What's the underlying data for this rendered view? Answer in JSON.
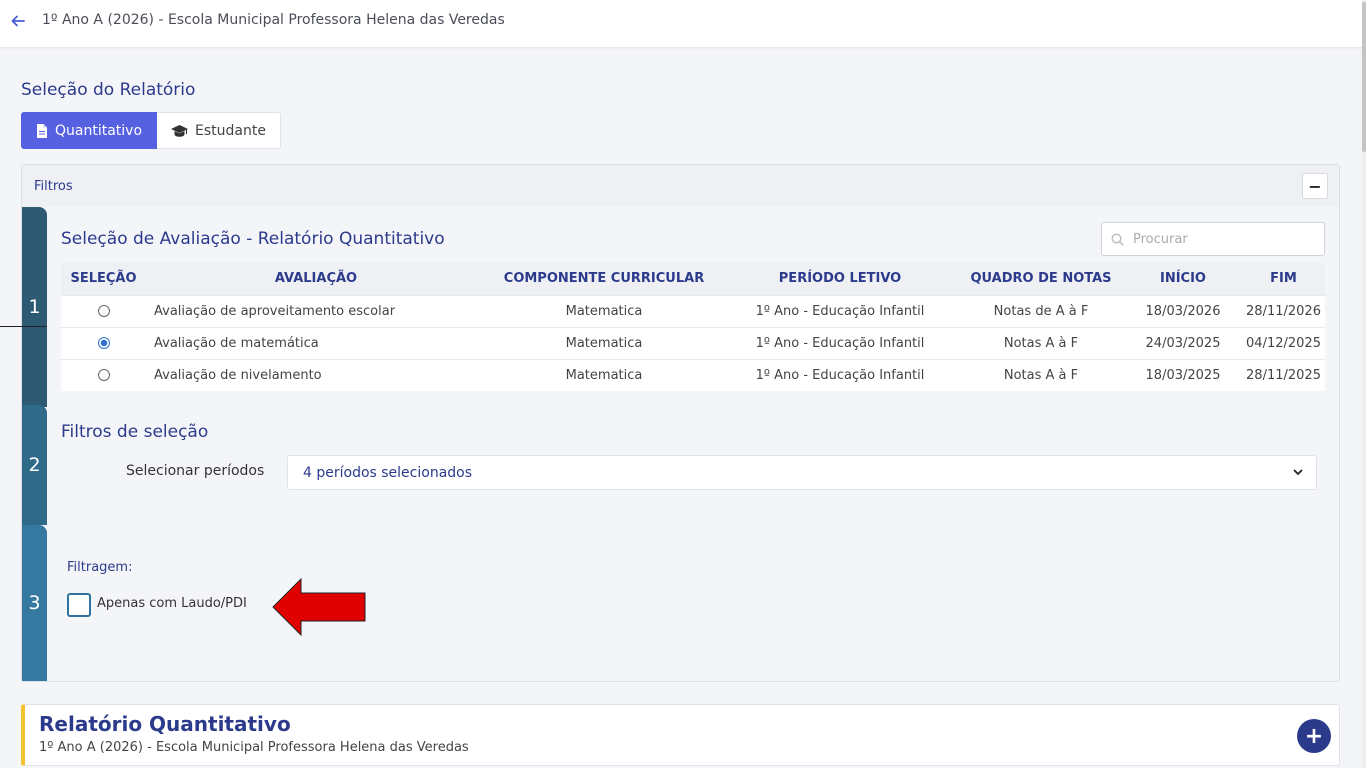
{
  "header": {
    "title": "1º Ano A (2026) - Escola Municipal Professora Helena das Veredas"
  },
  "report_selection": {
    "title": "Seleção do Relatório",
    "tabs": [
      {
        "label": "Quantitativo",
        "icon": "document-icon",
        "active": true
      },
      {
        "label": "Estudante",
        "icon": "graduation-cap-icon",
        "active": false
      }
    ]
  },
  "filters": {
    "title": "Filtros",
    "collapse_label": "−",
    "steps": [
      "1",
      "2",
      "3"
    ],
    "evaluation": {
      "title": "Seleção de Avaliação - Relatório Quantitativo",
      "search_placeholder": "Procurar",
      "columns": [
        "SELEÇÃO",
        "AVALIAÇÃO",
        "COMPONENTE CURRICULAR",
        "PERÍODO LETIVO",
        "QUADRO DE NOTAS",
        "INÍCIO",
        "FIM"
      ],
      "rows": [
        {
          "selected": false,
          "name": "Avaliação de aproveitamento escolar",
          "component": "Matematica",
          "period": "1º Ano - Educação Infantil",
          "grades": "Notas de A à F",
          "start": "18/03/2026",
          "end": "28/11/2026"
        },
        {
          "selected": true,
          "name": "Avaliação de matemática",
          "component": "Matematica",
          "period": "1º Ano - Educação Infantil",
          "grades": "Notas A à F",
          "start": "24/03/2025",
          "end": "04/12/2025"
        },
        {
          "selected": false,
          "name": "Avaliação de nivelamento",
          "component": "Matematica",
          "period": "1º Ano - Educação Infantil",
          "grades": "Notas A à F",
          "start": "18/03/2025",
          "end": "28/11/2025"
        }
      ]
    },
    "selection_filters": {
      "title": "Filtros de seleção",
      "periods_label": "Selecionar períodos",
      "periods_value": "4 períodos selecionados"
    },
    "filtering": {
      "label": "Filtragem:",
      "laudo_label": "Apenas com Laudo/PDI",
      "laudo_checked": false
    }
  },
  "report": {
    "title": "Relatório Quantitativo",
    "subtitle": "1º Ano A (2026) - Escola Municipal Professora Helena das Veredas",
    "add_label": "+"
  },
  "colors": {
    "primary": "#5661e2",
    "heading": "#2c3a8c",
    "accent_yellow": "#f2c230",
    "arrow_red": "#e00000"
  }
}
